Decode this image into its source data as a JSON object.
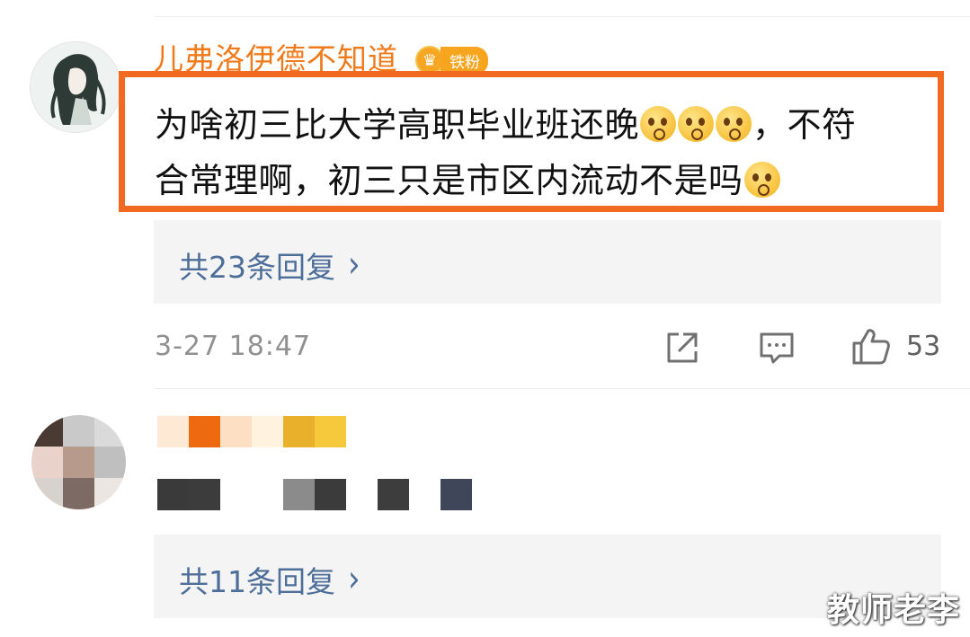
{
  "comment1": {
    "username": "儿弗洛伊德不知道",
    "badge": "铁粉",
    "text_line1": "为啥初三比大学高职毕业班还晚",
    "text_line1_tail": "，不符",
    "text_line2": "合常理啊，初三只是市区内流动不是吗",
    "emoji_name": "shush-face-emoji",
    "replies_label": "共23条回复",
    "time": "3-27 18:47",
    "likes": "53"
  },
  "comment2": {
    "replies_label": "共11条回复"
  },
  "icons": {
    "share": "share-icon",
    "comment": "comment-icon",
    "like": "thumbs-up-icon",
    "chevron": "chevron-right-icon"
  },
  "colors": {
    "highlight": "#f26a21",
    "username": "#f07a1a",
    "link": "#4c6e99",
    "meta": "#909090"
  },
  "watermark": "教师老李"
}
